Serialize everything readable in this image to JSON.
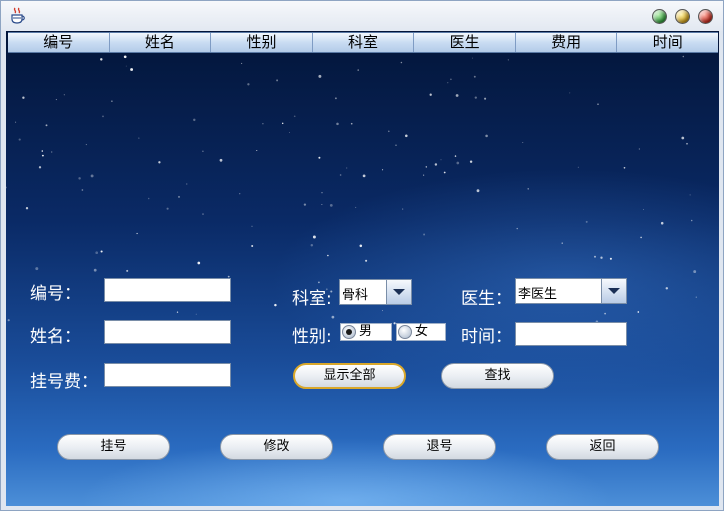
{
  "window": {
    "icon": "java-coffee-cup-icon",
    "controls": [
      "minimize",
      "maximize",
      "close"
    ]
  },
  "table": {
    "columns": [
      "编号",
      "姓名",
      "性别",
      "科室",
      "医生",
      "费用",
      "时间"
    ]
  },
  "form": {
    "id_label": "编号：",
    "id_value": "",
    "name_label": "姓名：",
    "name_value": "",
    "fee_label": "挂号费：",
    "fee_value": "",
    "dept_label": "科室:",
    "dept_value": "骨科",
    "gender_label": "性别:",
    "gender_options": [
      {
        "label": "男",
        "selected": true
      },
      {
        "label": "女",
        "selected": false
      }
    ],
    "doctor_label": "医生：",
    "doctor_value": "李医生",
    "time_label": "时间：",
    "time_value": ""
  },
  "buttons": {
    "show_all": "显示全部",
    "search": "查找",
    "register": "挂号",
    "modify": "修改",
    "cancel_registration": "退号",
    "back": "返回"
  }
}
